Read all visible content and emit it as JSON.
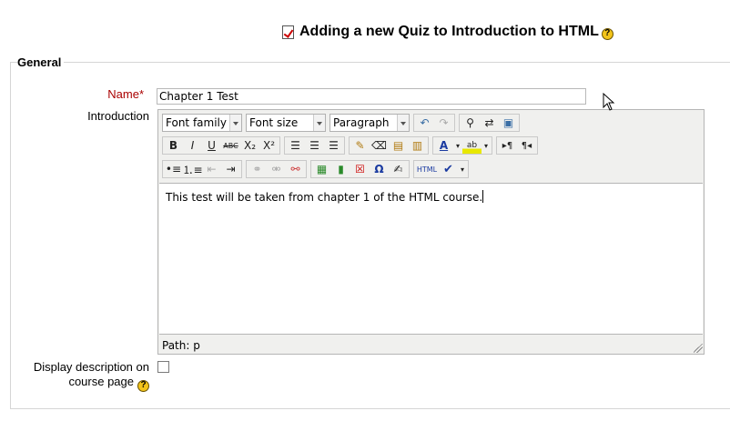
{
  "page": {
    "title": "Adding a new Quiz to Introduction to HTML",
    "icon": "quiz-icon",
    "help_icon": "help-icon",
    "help_glyph": "?"
  },
  "fieldset": {
    "legend": "General"
  },
  "name_field": {
    "label": "Name",
    "required_mark": "*",
    "value": "Chapter 1 Test"
  },
  "introduction": {
    "label": "Introduction",
    "toolbar": {
      "font_family": "Font family",
      "font_size": "Font size",
      "format": "Paragraph",
      "bold": "B",
      "italic": "I",
      "underline": "U",
      "strike": "ABC",
      "subscript": "X₂",
      "superscript": "X²",
      "html": "HTML",
      "omega": "Ω"
    },
    "content": "This test will be taken from chapter 1 of the HTML course.",
    "path_label": "Path: p"
  },
  "display_description": {
    "label": "Display description on course page",
    "checked": false
  }
}
